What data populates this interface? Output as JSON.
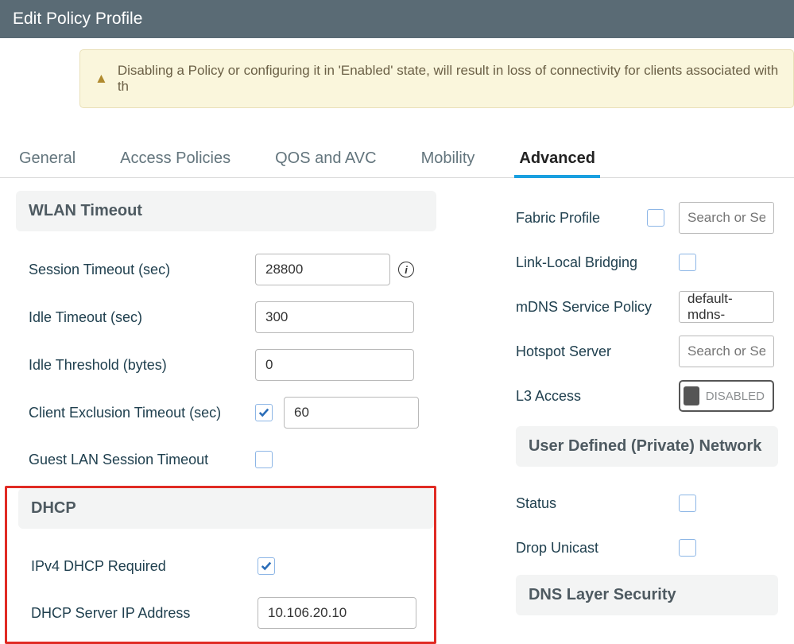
{
  "header": {
    "title": "Edit Policy Profile"
  },
  "alert": {
    "icon": "warning-icon",
    "text": "Disabling a Policy or configuring it in 'Enabled' state, will result in loss of connectivity for clients associated with th"
  },
  "tabs": [
    {
      "label": "General",
      "active": false
    },
    {
      "label": "Access Policies",
      "active": false
    },
    {
      "label": "QOS and AVC",
      "active": false
    },
    {
      "label": "Mobility",
      "active": false
    },
    {
      "label": "Advanced",
      "active": true
    }
  ],
  "left": {
    "wlan_timeout": {
      "section_title": "WLAN Timeout",
      "session_timeout_label": "Session Timeout (sec)",
      "session_timeout_value": "28800",
      "idle_timeout_label": "Idle Timeout (sec)",
      "idle_timeout_value": "300",
      "idle_threshold_label": "Idle Threshold (bytes)",
      "idle_threshold_value": "0",
      "client_exclusion_label": "Client Exclusion Timeout (sec)",
      "client_exclusion_checked": true,
      "client_exclusion_value": "60",
      "guest_lan_label": "Guest LAN Session Timeout",
      "guest_lan_checked": false
    },
    "dhcp": {
      "section_title": "DHCP",
      "ipv4_req_label": "IPv4 DHCP Required",
      "ipv4_req_checked": true,
      "server_ip_label": "DHCP Server IP Address",
      "server_ip_value": "10.106.20.10"
    }
  },
  "right": {
    "fabric_profile_label": "Fabric Profile",
    "fabric_profile_checked": false,
    "fabric_profile_placeholder": "Search or Sele",
    "link_local_label": "Link-Local Bridging",
    "link_local_checked": false,
    "mdns_label": "mDNS Service Policy",
    "mdns_value": "default-mdns-",
    "hotspot_label": "Hotspot Server",
    "hotspot_placeholder": "Search or Sele",
    "l3_access_label": "L3 Access",
    "l3_access_state": "DISABLED",
    "udn_section": "User Defined (Private) Network",
    "status_label": "Status",
    "status_checked": false,
    "drop_unicast_label": "Drop Unicast",
    "drop_unicast_checked": false,
    "dns_section": "DNS Layer Security"
  }
}
